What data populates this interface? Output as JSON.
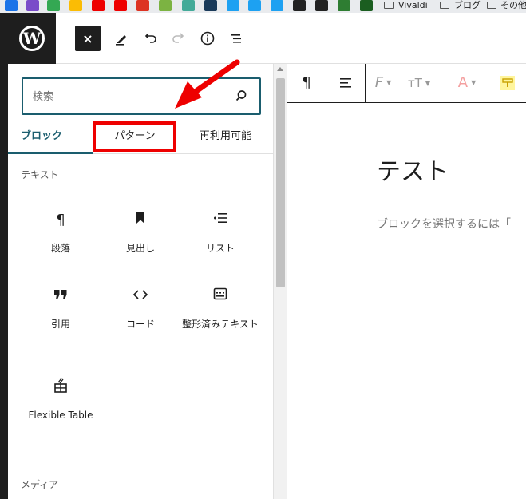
{
  "bookmarks": {
    "items": [
      {
        "icon": "vivaldi-bookmark-icon",
        "label": "Vivaldi"
      },
      {
        "icon": "folder-icon",
        "label": "ブログ"
      },
      {
        "icon": "folder-icon",
        "label": "その他"
      }
    ]
  },
  "toolbar": {
    "close_label": "×",
    "icons": [
      "close-icon",
      "edit-pen-icon",
      "undo-icon",
      "redo-icon",
      "info-icon",
      "list-view-icon"
    ]
  },
  "inserter": {
    "search_placeholder": "検索",
    "tabs": [
      {
        "label": "ブロック",
        "selected": true
      },
      {
        "label": "パターン",
        "selected": false
      },
      {
        "label": "再利用可能",
        "selected": false
      }
    ],
    "categories": [
      {
        "title": "テキスト",
        "blocks": [
          {
            "label": "段落",
            "icon": "paragraph-icon",
            "glyph": "¶"
          },
          {
            "label": "見出し",
            "icon": "heading-bookmark-icon",
            "glyph": ""
          },
          {
            "label": "リスト",
            "icon": "list-icon",
            "glyph": "⋮☰"
          },
          {
            "label": "引用",
            "icon": "quote-icon",
            "glyph": "❞"
          },
          {
            "label": "コード",
            "icon": "code-icon",
            "glyph": "‹›"
          },
          {
            "label": "整形済みテキスト",
            "icon": "preformatted-icon",
            "glyph": ""
          },
          {
            "label": "Flexible Table",
            "icon": "flexible-table-icon",
            "glyph": ""
          }
        ]
      },
      {
        "title": "メディア",
        "blocks": []
      }
    ]
  },
  "block_toolbar": {
    "icons": [
      "paragraph-icon",
      "align-icon",
      "font-family-icon",
      "font-size-icon",
      "text-color-icon",
      "highlight-icon"
    ]
  },
  "editor": {
    "title": "テスト",
    "hint": "ブロックを選択するには「"
  },
  "colors": {
    "accent": "#1a5d6e",
    "annotation_red": "#e00000",
    "dark": "#1e1e1e"
  }
}
